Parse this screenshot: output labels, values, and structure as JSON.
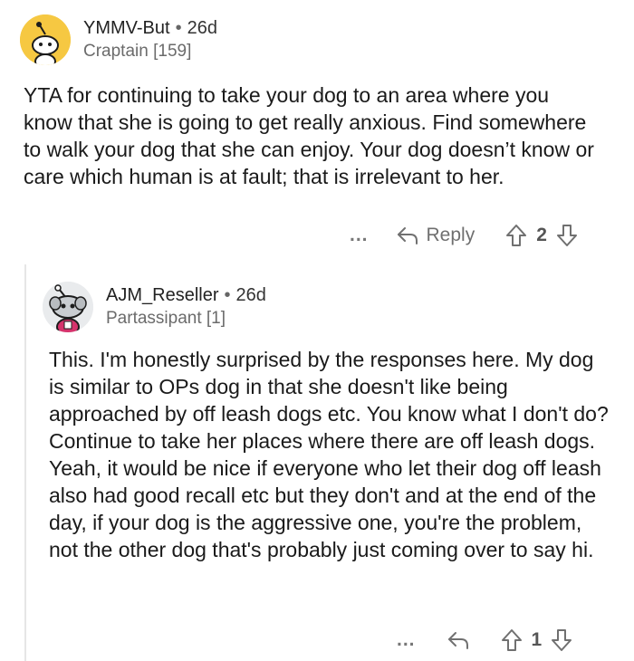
{
  "comments": [
    {
      "username": "YMMV-But",
      "separator": "•",
      "age": "26d",
      "flair": "Craptain [159]",
      "body": "YTA for continuing to take your dog to an area where you know that she is going to get really anxious. Find somewhere to walk your dog that she can enjoy. Your dog doesn’t know or care which human is at fault; that is irrelevant to her.",
      "more_label": "...",
      "reply_label": "Reply",
      "votes": "2",
      "avatar_color": "#f6c842"
    },
    {
      "username": "AJM_Reseller",
      "separator": "•",
      "age": "26d",
      "flair": "Partassipant [1]",
      "body": "This. I'm honestly surprised by the responses here. My dog is similar to OPs dog in that she doesn't like being approached by off leash dogs etc. You know what I don't do? Continue to take her places where there are off leash dogs. Yeah, it would be nice if everyone who let their dog off leash also had good recall etc but they don't and at the end of the day, if your dog is the aggressive one, you're the problem, not the other dog that's probably just coming over to say hi.",
      "more_label": "...",
      "votes": "1",
      "avatar_color": "#e9ebed"
    }
  ],
  "icons": [
    "snoo-avatar-icon",
    "reply-arrow-icon",
    "upvote-arrow-icon",
    "downvote-arrow-icon"
  ]
}
